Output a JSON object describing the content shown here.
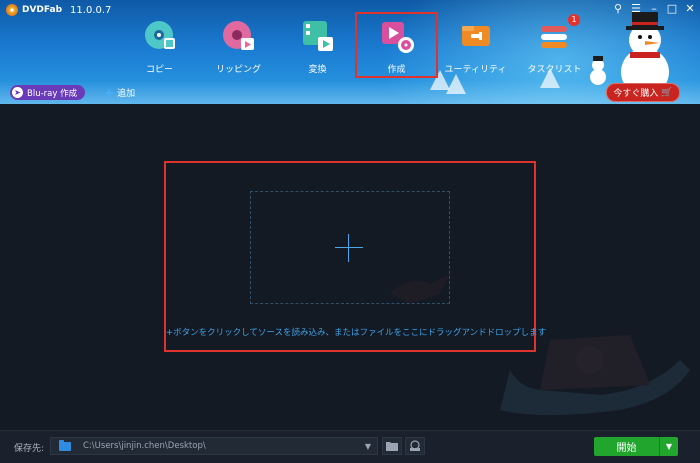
{
  "app": {
    "brand": "DVDFab",
    "version": "11.0.0.7"
  },
  "nav": [
    {
      "label": "コピー",
      "icon": "copy-disc-icon",
      "color": "#4ec7c9"
    },
    {
      "label": "リッピング",
      "icon": "ripper-icon",
      "color": "#e06aa0"
    },
    {
      "label": "変換",
      "icon": "converter-icon",
      "color": "#3fbfa6"
    },
    {
      "label": "作成",
      "icon": "creator-icon",
      "color": "#d84f9e"
    },
    {
      "label": "ユーティリティ",
      "icon": "utilities-icon",
      "color": "#f08a24"
    },
    {
      "label": "タスクリスト",
      "icon": "task-list-icon",
      "color": "#e35a5a",
      "badge": "1"
    }
  ],
  "active_nav": "作成",
  "toolbar": {
    "mode_label": "Blu-ray 作成",
    "add_label": "追加",
    "buy_label": "今すぐ購入"
  },
  "dropzone": {
    "hint": "+ボタンをクリックしてソースを読み込み、またはファイルをここにドラッグアンドドロップします"
  },
  "footer": {
    "save_label": "保存先:",
    "path": "C:\\Users\\jinjin.chen\\Desktop\\",
    "start_label": "開始"
  },
  "colors": {
    "accent": "#2c9ee6",
    "highlight_box": "#e0332d",
    "start_green": "#22a52c"
  }
}
